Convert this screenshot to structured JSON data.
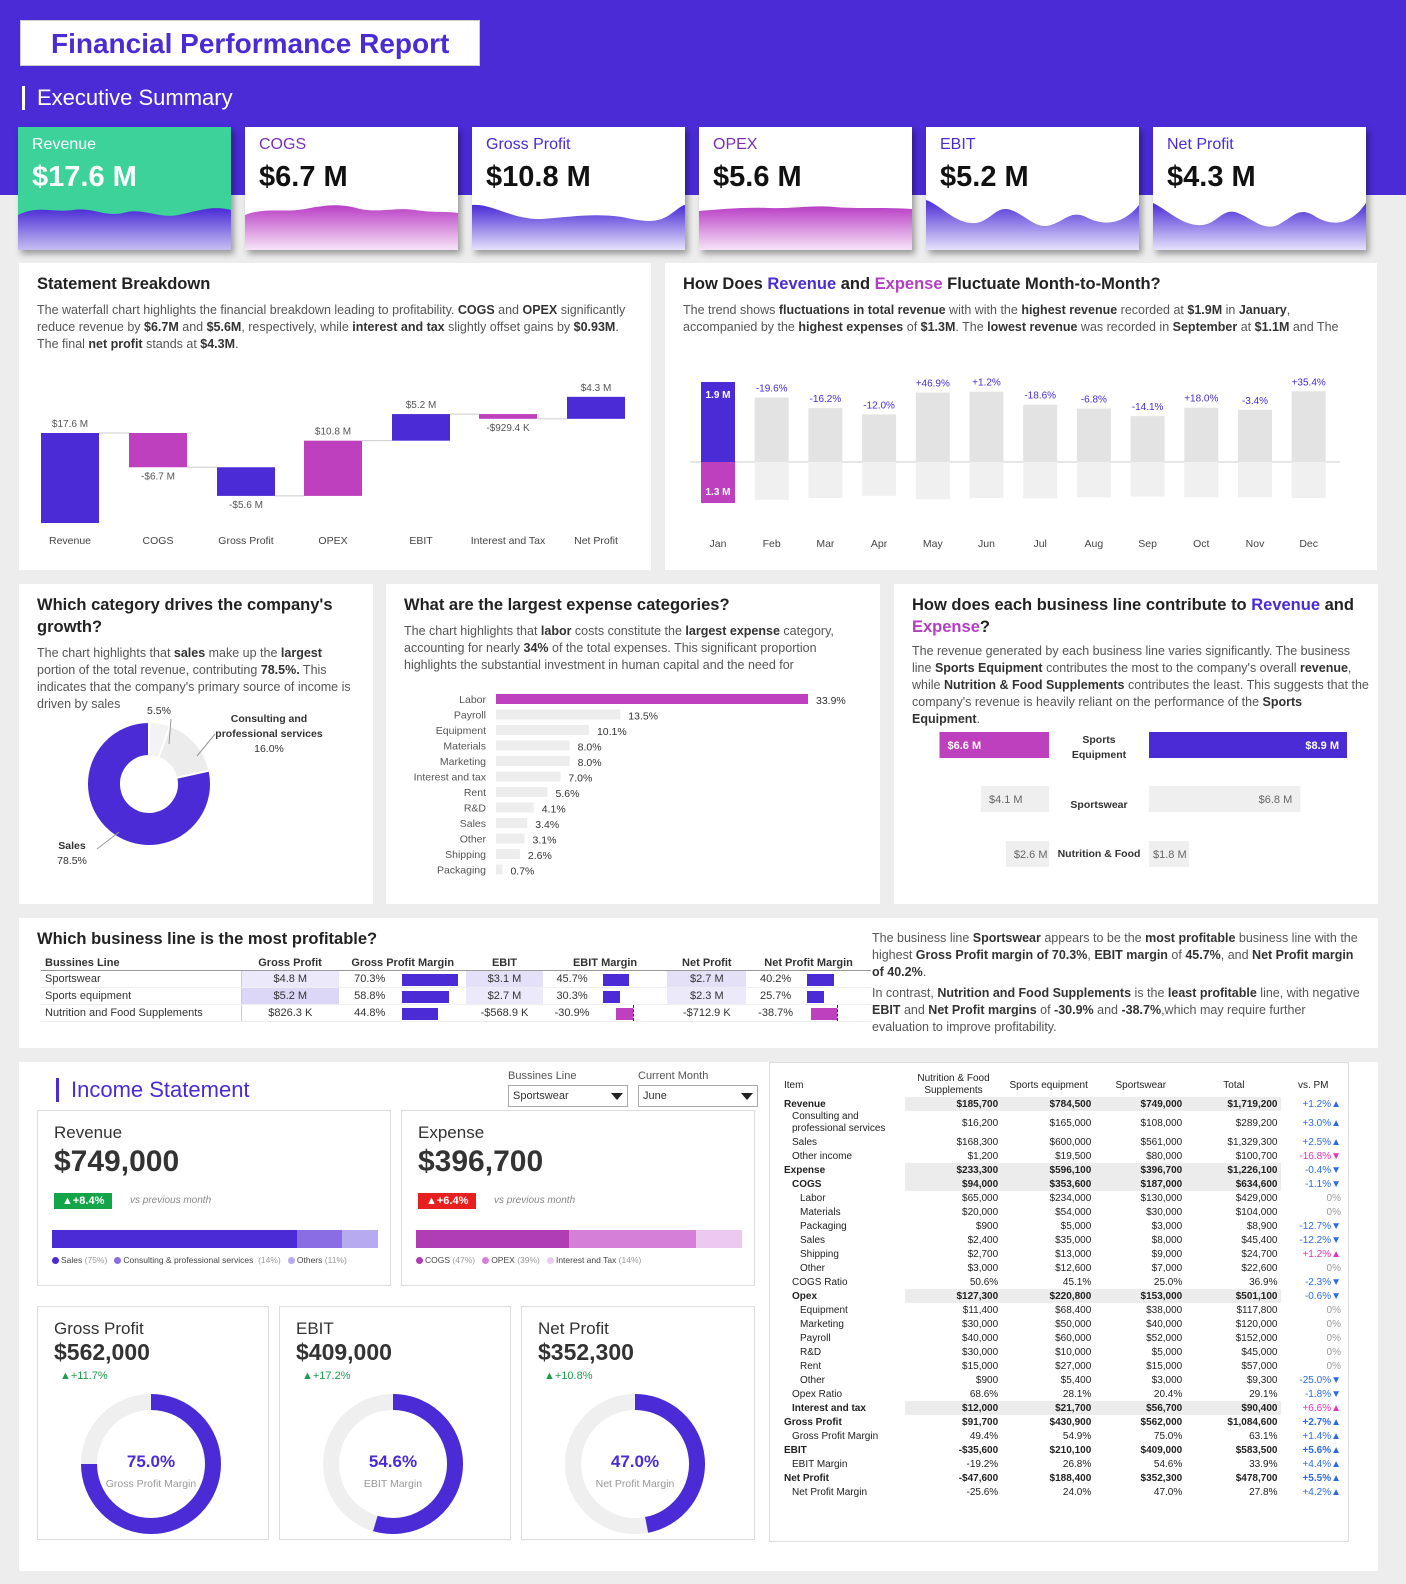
{
  "header": {
    "title": "Financial Performance Report",
    "section": "Executive Summary"
  },
  "kpis": [
    {
      "label": "Revenue",
      "value": "$17.6 M"
    },
    {
      "label": "COGS",
      "value": "$6.7 M"
    },
    {
      "label": "Gross Profit",
      "value": "$10.8 M"
    },
    {
      "label": "OPEX",
      "value": "$5.6 M"
    },
    {
      "label": "EBIT",
      "value": "$5.2 M"
    },
    {
      "label": "Net Profit",
      "value": "$4.3 M"
    }
  ],
  "statement": {
    "title": "Statement Breakdown",
    "text": "The waterfall chart highlights the financial breakdown leading to profitability. COGS and OPEX significantly reduce revenue by $6.7M and $5.6M, respectively, while interest and tax slightly offset gains by $0.93M. The final net profit stands at $4.3M."
  },
  "monthly": {
    "title_pre": "How Does ",
    "title_rev": "Revenue",
    "title_mid": " and ",
    "title_exp": "Expense",
    "title_post": " Fluctuate Month-to-Month?",
    "text": "The trend shows fluctuations in total revenue with with the highest revenue recorded at $1.9M in January, accompanied by the highest expenses of $1.3M. The lowest revenue was recorded in September at $1.1M and The"
  },
  "category": {
    "title": "Which category drives the company's growth?",
    "text": "The chart highlights that sales make up the largest portion of the total revenue, contributing 78.5%. This indicates that the company's primary source of income is driven by sales"
  },
  "expenses": {
    "title": "What are the largest expense categories?",
    "text": "The chart highlights that labor costs constitute the largest expense category, accounting for nearly 34% of the total expenses. This significant proportion highlights the substantial investment in human capital and the need for"
  },
  "business": {
    "title_pre": "How does each business line contribute to ",
    "title_rev": "Revenue",
    "title_mid": " and ",
    "title_exp": "Expense",
    "title_post": "?",
    "text": "The revenue generated by each business line varies significantly. The business line Sports Equipment contributes the most to the company's overall revenue, while Nutrition & Food Supplements contributes the least. This suggests that the company's revenue is heavily reliant on the performance of the Sports Equipment."
  },
  "profitable": {
    "title": "Which business line is the most profitable?",
    "columns": [
      "Bussines Line",
      "Gross Profit",
      "Gross Profit Margin",
      "EBIT",
      "EBIT Margin",
      "Net Profit",
      "Net Profit Margin"
    ],
    "rows": [
      {
        "line": "Sportswear",
        "gp": "$4.8 M",
        "gpm": "70.3%",
        "gpm_v": 70.3,
        "ebit": "$3.1 M",
        "ebitm": "45.7%",
        "ebitm_v": 45.7,
        "np": "$2.7 M",
        "npm": "40.2%",
        "npm_v": 40.2
      },
      {
        "line": "Sports equipment",
        "gp": "$5.2 M",
        "gpm": "58.8%",
        "gpm_v": 58.8,
        "ebit": "$2.7 M",
        "ebitm": "30.3%",
        "ebitm_v": 30.3,
        "np": "$2.3 M",
        "npm": "25.7%",
        "npm_v": 25.7
      },
      {
        "line": "Nutrition and Food Supplements",
        "gp": "$826.3 K",
        "gpm": "44.8%",
        "gpm_v": 44.8,
        "ebit": "-$568.9 K",
        "ebitm": "-30.9%",
        "ebitm_v": -30.9,
        "np": "-$712.9 K",
        "npm": "-38.7%",
        "npm_v": -38.7
      }
    ],
    "text1": "The business line Sportswear appears to be the most profitable business line with the highest Gross Profit margin of 70.3%, EBIT margin of 45.7%, and Net Profit margin of 40.2%.",
    "text2": "In contrast, Nutrition and Food Supplements is the least profitable line, with negative EBIT and Net Profit margins of -30.9% and -38.7%,which may require further evaluation to improve profitability."
  },
  "income": {
    "title": "Income Statement",
    "filter_line_label": "Bussines Line",
    "filter_line_value": "Sportswear",
    "filter_month_label": "Current Month",
    "filter_month_value": "June",
    "revenue": {
      "label": "Revenue",
      "value": "$749,000",
      "badge": "▲+8.4%",
      "vs": "vs previous month",
      "legend": [
        {
          "name": "Sales",
          "pct": "(75%)",
          "share": 75
        },
        {
          "name": "Consulting & professional services",
          "pct": "(14%)",
          "share": 14
        },
        {
          "name": "Others",
          "pct": "(11%)",
          "share": 11
        }
      ]
    },
    "expense": {
      "label": "Expense",
      "value": "$396,700",
      "badge": "▲+6.4%",
      "vs": "vs previous month",
      "legend": [
        {
          "name": "COGS",
          "pct": "(47%)",
          "share": 47
        },
        {
          "name": "OPEX",
          "pct": "(39%)",
          "share": 39
        },
        {
          "name": "Interest and Tax",
          "pct": "(14%)",
          "share": 14
        }
      ]
    },
    "gross": {
      "label": "Gross Profit",
      "value": "$562,000",
      "change": "▲+11.7%",
      "pct": "75.0%",
      "pct_v": 75.0,
      "sub": "Gross Profit Margin"
    },
    "ebit": {
      "label": "EBIT",
      "value": "$409,000",
      "change": "▲+17.2%",
      "pct": "54.6%",
      "pct_v": 54.6,
      "sub": "EBIT Margin"
    },
    "net": {
      "label": "Net Profit",
      "value": "$352,300",
      "change": "▲+10.8%",
      "pct": "47.0%",
      "pct_v": 47.0,
      "sub": "Net Profit Margin"
    }
  },
  "is_table": {
    "headers": [
      "Item",
      "Nutrition & Food Supplements",
      "Sports equipment",
      "Sportswear",
      "Total",
      "vs. PM"
    ],
    "rows": [
      {
        "item": "Revenue",
        "v": [
          "$185,700",
          "$784,500",
          "$749,000",
          "$1,719,200"
        ],
        "pm": "+1.2%▲",
        "style": "hl",
        "pmc": "up"
      },
      {
        "item": "Consulting and professional services",
        "v": [
          "$16,200",
          "$165,000",
          "$108,000",
          "$289,200"
        ],
        "pm": "+3.0%▲",
        "style": "sub",
        "pmc": "up"
      },
      {
        "item": "Sales",
        "v": [
          "$168,300",
          "$600,000",
          "$561,000",
          "$1,329,300"
        ],
        "pm": "+2.5%▲",
        "style": "sub",
        "pmc": "up"
      },
      {
        "item": "Other income",
        "v": [
          "$1,200",
          "$19,500",
          "$80,000",
          "$100,700"
        ],
        "pm": "-16.8%▼",
        "style": "sub",
        "pmc": "pk"
      },
      {
        "item": "Expense",
        "v": [
          "$233,300",
          "$596,100",
          "$396,700",
          "$1,226,100"
        ],
        "pm": "-0.4%▼",
        "style": "hl",
        "pmc": "up"
      },
      {
        "item": "COGS",
        "v": [
          "$94,000",
          "$353,600",
          "$187,000",
          "$634,600"
        ],
        "pm": "-1.1%▼",
        "style": "hl2",
        "pmc": "up"
      },
      {
        "item": "Labor",
        "v": [
          "$65,000",
          "$234,000",
          "$130,000",
          "$429,000"
        ],
        "pm": "0%",
        "style": "sub2",
        "pmc": "zero"
      },
      {
        "item": "Materials",
        "v": [
          "$20,000",
          "$54,000",
          "$30,000",
          "$104,000"
        ],
        "pm": "0%",
        "style": "sub2",
        "pmc": "zero"
      },
      {
        "item": "Packaging",
        "v": [
          "$900",
          "$5,000",
          "$3,000",
          "$8,900"
        ],
        "pm": "-12.7%▼",
        "style": "sub2",
        "pmc": "up"
      },
      {
        "item": "Sales",
        "v": [
          "$2,400",
          "$35,000",
          "$8,000",
          "$45,400"
        ],
        "pm": "-12.2%▼",
        "style": "sub2",
        "pmc": "up"
      },
      {
        "item": "Shipping",
        "v": [
          "$2,700",
          "$13,000",
          "$9,000",
          "$24,700"
        ],
        "pm": "+1.2%▲",
        "style": "sub2",
        "pmc": "pk"
      },
      {
        "item": "Other",
        "v": [
          "$3,000",
          "$12,600",
          "$7,000",
          "$22,600"
        ],
        "pm": "0%",
        "style": "sub2",
        "pmc": "zero"
      },
      {
        "item": "COGS Ratio",
        "v": [
          "50.6%",
          "45.1%",
          "25.0%",
          "36.9%"
        ],
        "pm": "-2.3%▼",
        "style": "sub",
        "pmc": "up"
      },
      {
        "item": "Opex",
        "v": [
          "$127,300",
          "$220,800",
          "$153,000",
          "$501,100"
        ],
        "pm": "-0.6%▼",
        "style": "hl2",
        "pmc": "up"
      },
      {
        "item": "Equipment",
        "v": [
          "$11,400",
          "$68,400",
          "$38,000",
          "$117,800"
        ],
        "pm": "0%",
        "style": "sub2",
        "pmc": "zero"
      },
      {
        "item": "Marketing",
        "v": [
          "$30,000",
          "$50,000",
          "$40,000",
          "$120,000"
        ],
        "pm": "0%",
        "style": "sub2",
        "pmc": "zero"
      },
      {
        "item": "Payroll",
        "v": [
          "$40,000",
          "$60,000",
          "$52,000",
          "$152,000"
        ],
        "pm": "0%",
        "style": "sub2",
        "pmc": "zero"
      },
      {
        "item": "R&D",
        "v": [
          "$30,000",
          "$10,000",
          "$5,000",
          "$45,000"
        ],
        "pm": "0%",
        "style": "sub2",
        "pmc": "zero"
      },
      {
        "item": "Rent",
        "v": [
          "$15,000",
          "$27,000",
          "$15,000",
          "$57,000"
        ],
        "pm": "0%",
        "style": "sub2",
        "pmc": "zero"
      },
      {
        "item": "Other",
        "v": [
          "$900",
          "$5,400",
          "$3,000",
          "$9,300"
        ],
        "pm": "-25.0%▼",
        "style": "sub2",
        "pmc": "up"
      },
      {
        "item": "Opex Ratio",
        "v": [
          "68.6%",
          "28.1%",
          "20.4%",
          "29.1%"
        ],
        "pm": "-1.8%▼",
        "style": "sub",
        "pmc": "up"
      },
      {
        "item": "Interest and tax",
        "v": [
          "$12,000",
          "$21,700",
          "$56,700",
          "$90,400"
        ],
        "pm": "+6.6%▲",
        "style": "hl2",
        "pmc": "pk"
      },
      {
        "item": "Gross Profit",
        "v": [
          "$91,700",
          "$430,900",
          "$562,000",
          "$1,084,600"
        ],
        "pm": "+2.7%▲",
        "style": "bold",
        "pmc": "up"
      },
      {
        "item": "Gross Profit Margin",
        "v": [
          "49.4%",
          "54.9%",
          "75.0%",
          "63.1%"
        ],
        "pm": "+1.4%▲",
        "style": "sub",
        "pmc": "up"
      },
      {
        "item": "EBIT",
        "v": [
          "-$35,600",
          "$210,100",
          "$409,000",
          "$583,500"
        ],
        "pm": "+5.6%▲",
        "style": "bold",
        "pmc": "up"
      },
      {
        "item": "EBIT Margin",
        "v": [
          "-19.2%",
          "26.8%",
          "54.6%",
          "33.9%"
        ],
        "pm": "+4.4%▲",
        "style": "sub",
        "pmc": "up"
      },
      {
        "item": "Net Profit",
        "v": [
          "-$47,600",
          "$188,400",
          "$352,300",
          "$478,700"
        ],
        "pm": "+5.5%▲",
        "style": "bold",
        "pmc": "up"
      },
      {
        "item": "Net Profit Margin",
        "v": [
          "-25.6%",
          "24.0%",
          "47.0%",
          "27.8%"
        ],
        "pm": "+4.2%▲",
        "style": "sub",
        "pmc": "up"
      }
    ]
  },
  "colors": {
    "primary": "#4a2bd6",
    "magenta": "#bf40bf",
    "green": "#3ed29b",
    "grey": "#e3e3e3"
  },
  "chart_data": [
    {
      "type": "bar",
      "subtype": "waterfall",
      "title": "Statement Breakdown",
      "categories": [
        "Revenue",
        "COGS",
        "Gross Profit",
        "OPEX",
        "EBIT",
        "Interest and Tax",
        "Net Profit"
      ],
      "values": [
        17.6,
        -6.7,
        -5.6,
        10.8,
        5.2,
        -0.9294,
        4.3
      ],
      "labels": [
        "$17.6 M",
        "-$6.7 M",
        "-$5.6 M",
        "$10.8 M",
        "$5.2 M",
        "-$929.4 K",
        "$4.3 M"
      ]
    },
    {
      "type": "bar",
      "title": "Monthly Revenue and Expense",
      "categories": [
        "Jan",
        "Feb",
        "Mar",
        "Apr",
        "May",
        "Jun",
        "Jul",
        "Aug",
        "Sep",
        "Oct",
        "Nov",
        "Dec"
      ],
      "series": [
        {
          "name": "Revenue",
          "values": [
            1.9,
            1.53,
            1.28,
            1.13,
            1.65,
            1.67,
            1.36,
            1.27,
            1.09,
            1.29,
            1.24,
            1.68
          ]
        },
        {
          "name": "Expense",
          "values": [
            1.3,
            1.2,
            1.14,
            1.07,
            1.18,
            1.14,
            1.15,
            1.12,
            1.09,
            1.12,
            1.12,
            1.14
          ]
        }
      ],
      "change_labels": [
        "",
        "-19.6%",
        "-16.2%",
        "-12.0%",
        "+46.9%",
        "+1.2%",
        "-18.6%",
        "-6.8%",
        "-14.1%",
        "+18.0%",
        "-3.4%",
        "+35.4%"
      ],
      "jan_labels": [
        "1.9 M",
        "1.3 M"
      ]
    },
    {
      "type": "pie",
      "subtype": "donut",
      "title": "Revenue by category",
      "categories": [
        "Sales",
        "Consulting and professional services",
        "Other income"
      ],
      "values": [
        78.5,
        16.0,
        5.5
      ],
      "labels": [
        "78.5%",
        "16.0%",
        "5.5%"
      ],
      "names": [
        "Sales",
        "Consulting and professional services",
        "Other income"
      ]
    },
    {
      "type": "bar",
      "orientation": "horizontal",
      "title": "Expense categories",
      "categories": [
        "Labor",
        "Payroll",
        "Equipment",
        "Materials",
        "Marketing",
        "Interest and tax",
        "Rent",
        "R&D",
        "Sales",
        "Other",
        "Shipping",
        "Packaging"
      ],
      "values": [
        33.9,
        13.5,
        10.1,
        8.0,
        8.0,
        7.0,
        5.6,
        4.1,
        3.4,
        3.1,
        2.6,
        0.7
      ],
      "labels": [
        "33.9%",
        "13.5%",
        "10.1%",
        "8.0%",
        "8.0%",
        "7.0%",
        "5.6%",
        "4.1%",
        "3.4%",
        "3.1%",
        "2.6%",
        "0.7%"
      ]
    },
    {
      "type": "bar",
      "orientation": "horizontal",
      "subtype": "butterfly",
      "title": "Business line Revenue and Expense",
      "categories": [
        "Sports Equipment",
        "Sportswear",
        "Nutrition & Food"
      ],
      "series": [
        {
          "name": "Expense",
          "values": [
            6.6,
            4.1,
            2.6
          ],
          "labels": [
            "$6.6 M",
            "$4.1 M",
            "$2.6 M"
          ]
        },
        {
          "name": "Revenue",
          "values": [
            8.9,
            6.8,
            1.8
          ],
          "labels": [
            "$8.9 M",
            "$6.8 M",
            "$1.8 M"
          ]
        }
      ]
    }
  ]
}
